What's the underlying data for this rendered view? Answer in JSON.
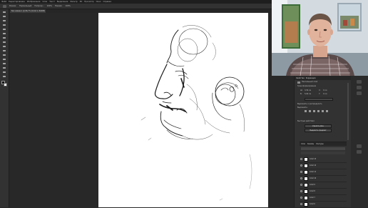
{
  "menu": {
    "items": [
      "Файл",
      "Редактирование",
      "Изображение",
      "Слои",
      "Текст",
      "Выделение",
      "Фильтр",
      "3D",
      "Просмотр",
      "Окно",
      "Справка"
    ]
  },
  "options": {
    "mode_label": "Режим:",
    "mode_value": "Нормальный",
    "opacity_label": "Непрозр.:",
    "opacity_value": "100%",
    "flow_label": "Нажим:",
    "flow_value": "100%"
  },
  "document": {
    "tab_title": "Без имени-1 @ 66,7% (Слой 1, RGB/8) *"
  },
  "properties": {
    "tabs": [
      "Свойства",
      "Коррекция"
    ],
    "section_title": "Пиксельный слой",
    "transform_label": "Трансформирование",
    "w_label": "Ш:",
    "w_value": "3,56 см",
    "h_label": "В:",
    "h_value": "5,69 см",
    "x_label": "X:",
    "x_value": "0 см",
    "y_label": "Y:",
    "y_value": "0 см",
    "align_label": "Выровнять и распределить",
    "align_sub": "Выровнять:",
    "quick_label": "Быстрые действия",
    "remove_bg": "Удалить фон",
    "select_subject": "Выделить предмет"
  },
  "layers": {
    "tabs": [
      "Слои",
      "Каналы",
      "Контуры"
    ],
    "items": [
      "Слой 13",
      "Слой 12",
      "Слой 11",
      "Слой 10",
      "Слой 9",
      "Слой 8",
      "Слой 7",
      "Слой 6",
      "Слой 5"
    ]
  },
  "colors": {
    "ui_dark": "#282828",
    "panel": "#323232",
    "canvas": "#ffffff",
    "ink": "#1a1a1a"
  }
}
